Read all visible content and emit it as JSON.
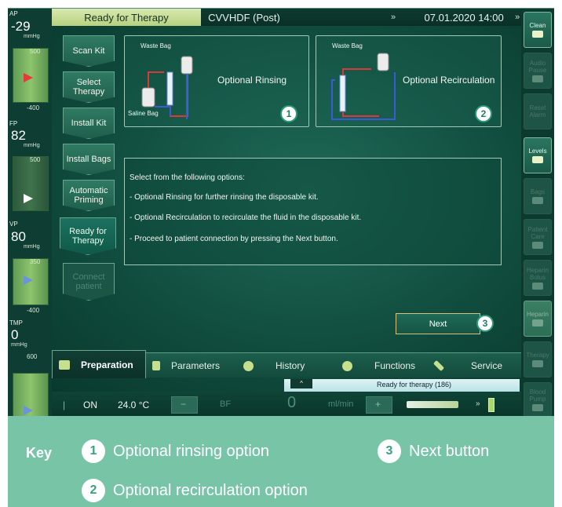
{
  "status_bar": {
    "state": "Ready for Therapy",
    "mode": "CVVHDF (Post)",
    "datetime": "07.01.2020 14:00"
  },
  "pressures": {
    "ap": {
      "label": "AP",
      "value": "-29",
      "unit": "mmHg",
      "top_tick": "500",
      "bottom_tick": "-400"
    },
    "fp": {
      "label": "FP",
      "value": "82",
      "unit": "mmHg",
      "top_tick": "500"
    },
    "vp": {
      "label": "VP",
      "value": "80",
      "unit": "mmHg",
      "top_tick": "350",
      "bottom_tick": "-400"
    },
    "tmp": {
      "label": "TMP",
      "value": "0",
      "unit": "mmHg",
      "top_tick": "600"
    }
  },
  "right_buttons": [
    {
      "label": "Clean",
      "icon": "clean-icon",
      "state": "on"
    },
    {
      "label": "Audio Pause",
      "icon": "speaker-icon",
      "state": "off"
    },
    {
      "label": "Reset Alarm",
      "icon": "",
      "state": "off"
    },
    {
      "label": "Levels",
      "icon": "levels-icon",
      "state": "on"
    },
    {
      "label": "Bags",
      "icon": "scale-icon",
      "state": "off"
    },
    {
      "label": "Patient Care",
      "icon": "patient-icon",
      "state": "off"
    },
    {
      "label": "Heparin Bolus",
      "icon": "bolus-icon",
      "state": "off"
    },
    {
      "label": "Heparin",
      "icon": "syringe-icon",
      "state": "lit"
    },
    {
      "label": "Therapy",
      "icon": "therapy-icon",
      "state": "off"
    },
    {
      "label": "Blood Pump",
      "icon": "pump-icon",
      "state": "off"
    }
  ],
  "steps": [
    {
      "label": "Scan Kit",
      "state": "done"
    },
    {
      "label": "Select Therapy",
      "state": "done"
    },
    {
      "label": "Install Kit",
      "state": "done"
    },
    {
      "label": "Install Bags",
      "state": "done"
    },
    {
      "label": "Automatic Priming",
      "state": "done"
    },
    {
      "label": "Ready for Therapy",
      "state": "active"
    },
    {
      "label": "Connect patient",
      "state": "disabled"
    }
  ],
  "options": {
    "rinsing": {
      "label": "Optional Rinsing",
      "waste": "Waste Bag",
      "saline": "Saline Bag",
      "callout": "1"
    },
    "recirculation": {
      "label": "Optional Recirculation",
      "waste": "Waste Bag",
      "callout": "2"
    }
  },
  "info": {
    "lines": [
      "Select from the following options:",
      "- Optional Rinsing for further rinsing the disposable kit.",
      "- Optional Recirculation to recirculate the fluid in the disposable kit.",
      "- Proceed to patient connection by pressing the Next button."
    ]
  },
  "next_button": {
    "label": "Next",
    "callout": "3"
  },
  "tabs": [
    {
      "label": "Preparation",
      "icon": "bag-icon",
      "active": true
    },
    {
      "label": "Parameters",
      "icon": "calculator-icon",
      "active": false
    },
    {
      "label": "History",
      "icon": "clock-icon",
      "active": false
    },
    {
      "label": "Functions",
      "icon": "gear-icon",
      "active": false
    },
    {
      "label": "Service",
      "icon": "wrench-icon",
      "active": false
    }
  ],
  "message": {
    "text": "Ready for therapy (186)"
  },
  "bottom_bar": {
    "heater_state": "ON",
    "temperature": "24.0 °C",
    "bf_label": "BF",
    "flow_value": "0",
    "flow_unit": "ml/min",
    "minus": "−",
    "plus": "+"
  },
  "key": {
    "title": "Key",
    "items": [
      {
        "number": "1",
        "text": "Optional rinsing option"
      },
      {
        "number": "2",
        "text": "Optional recirculation option"
      },
      {
        "number": "3",
        "text": "Next button"
      }
    ]
  },
  "colors": {
    "accent": "#77c4a6",
    "status": "#b7d17e",
    "message": "#b8e2e6"
  }
}
